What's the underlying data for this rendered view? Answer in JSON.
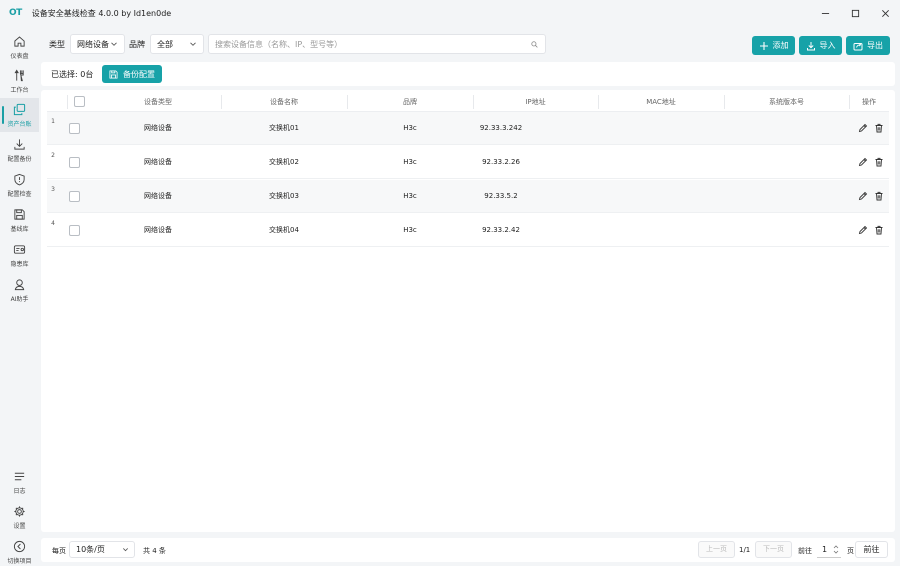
{
  "app": {
    "logo": "OT",
    "title": "设备安全基线检查 4.0.0 by Id1en0de"
  },
  "window_controls": {
    "minimize": "–",
    "maximize": "☐",
    "close": "✕"
  },
  "sidebar": {
    "items": [
      {
        "label": "仪表盘",
        "icon": "home-icon"
      },
      {
        "label": "工作台",
        "icon": "tools-icon"
      },
      {
        "label": "资产台账",
        "icon": "copy-icon",
        "active": true
      },
      {
        "label": "配置备份",
        "icon": "download-icon"
      },
      {
        "label": "配置检查",
        "icon": "shield-icon"
      },
      {
        "label": "基线库",
        "icon": "save-icon"
      },
      {
        "label": "隐患库",
        "icon": "alert-card-icon"
      },
      {
        "label": "AI助手",
        "icon": "ai-assistant-icon"
      }
    ],
    "bottom": [
      {
        "label": "日志",
        "icon": "menu-icon"
      },
      {
        "label": "设置",
        "icon": "gear-icon"
      },
      {
        "label": "切换项目",
        "icon": "chevron-left-circle-icon"
      }
    ]
  },
  "filters": {
    "type_label": "类型",
    "type_value": "网络设备",
    "brand_label": "品牌",
    "brand_value": "全部",
    "search_placeholder": "搜索设备信息（名称、IP、型号等）"
  },
  "toolbar": {
    "add": "添加",
    "import": "导入",
    "export": "导出"
  },
  "selection": {
    "text": "已选择: 0台",
    "backup": "备份配置"
  },
  "table": {
    "columns": [
      "设备类型",
      "设备名称",
      "品牌",
      "IP地址",
      "MAC地址",
      "系统版本号",
      "操作"
    ],
    "rows": [
      {
        "num": "1",
        "type": "网络设备",
        "name": "交换机01",
        "brand": "H3c",
        "ip": "92.33.3.242",
        "mac": "",
        "version": ""
      },
      {
        "num": "2",
        "type": "网络设备",
        "name": "交换机02",
        "brand": "H3c",
        "ip": "92.33.2.26",
        "mac": "",
        "version": ""
      },
      {
        "num": "3",
        "type": "网络设备",
        "name": "交换机03",
        "brand": "H3c",
        "ip": "92.33.5.2",
        "mac": "",
        "version": ""
      },
      {
        "num": "4",
        "type": "网络设备",
        "name": "交换机04",
        "brand": "H3c",
        "ip": "92.33.2.42",
        "mac": "",
        "version": ""
      }
    ]
  },
  "pagination": {
    "per_page_label": "每页",
    "page_size": "10条/页",
    "total": "共 4 条",
    "prev": "上一页",
    "page_info": "1/1",
    "next": "下一页",
    "goto_label": "前往",
    "page_input": "1",
    "page_unit": "页",
    "goto_button": "前往"
  },
  "colors": {
    "accent": "#17a2a8",
    "background": "#f3f5f7"
  }
}
